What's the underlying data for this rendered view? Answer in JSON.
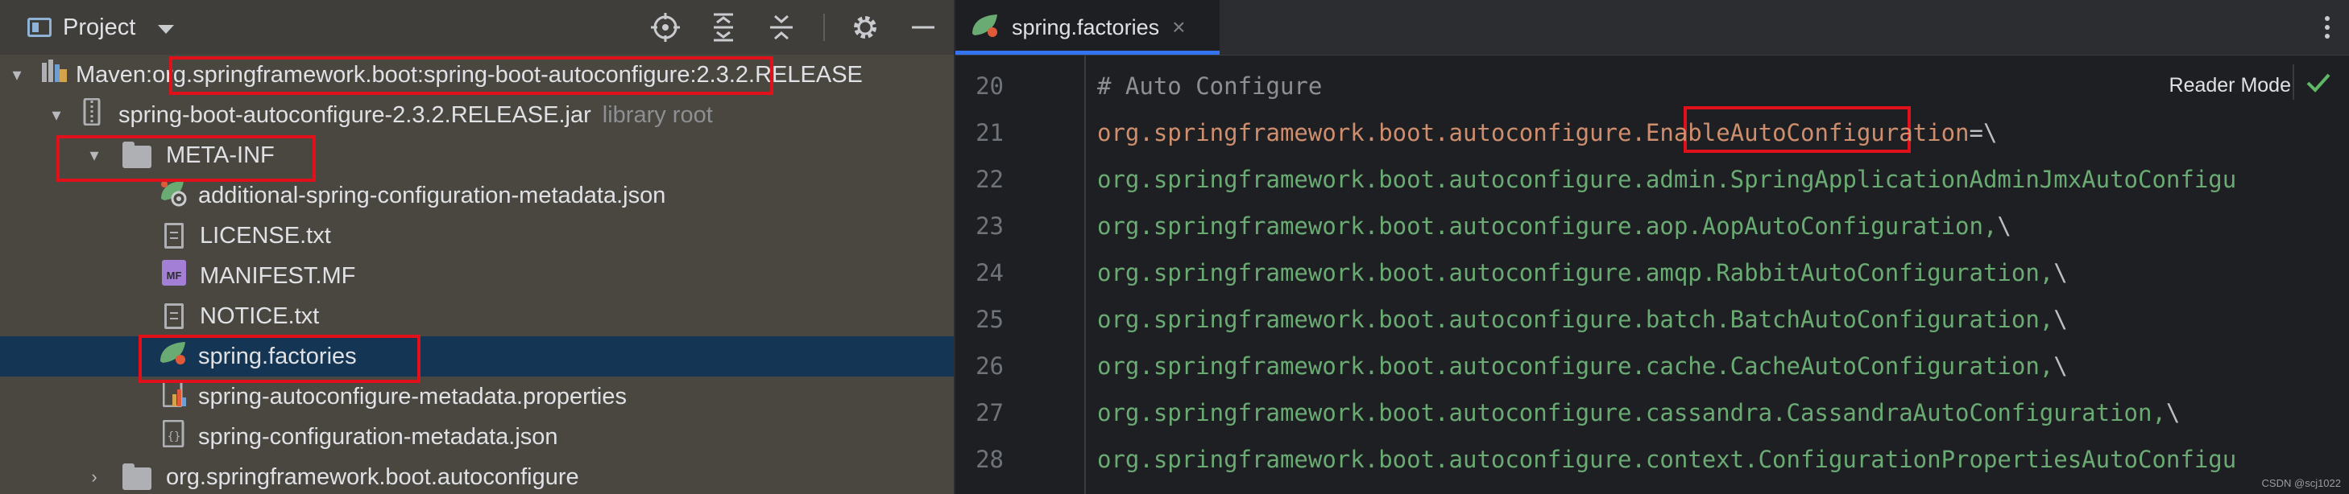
{
  "project_panel": {
    "title": "Project",
    "header_icons": [
      "locate-icon",
      "expand-all-icon",
      "collapse-all-icon",
      "gear-icon",
      "minimize-icon"
    ],
    "tree": [
      {
        "prefix": "Maven: ",
        "label": "org.springframework.boot:spring-boot-autoconfigure:",
        "suffix": "2.3.2.RELEASE",
        "icon": "maven-library-icon",
        "expanded": true
      },
      {
        "label": "spring-boot-autoconfigure-2.3.2.RELEASE.jar",
        "hint": "library root",
        "icon": "jar-icon",
        "expanded": true
      },
      {
        "label": "META-INF",
        "icon": "folder-icon",
        "expanded": true
      },
      {
        "label": "additional-spring-configuration-metadata.json",
        "icon": "spring-json-icon"
      },
      {
        "label": "LICENSE.txt",
        "icon": "text-file-icon"
      },
      {
        "label": "MANIFEST.MF",
        "icon": "manifest-icon"
      },
      {
        "label": "NOTICE.txt",
        "icon": "text-file-icon"
      },
      {
        "label": "spring.factories",
        "icon": "spring-leaf-icon",
        "selected": true
      },
      {
        "label": "spring-autoconfigure-metadata.properties",
        "icon": "properties-icon"
      },
      {
        "label": "spring-configuration-metadata.json",
        "icon": "json-icon"
      },
      {
        "label": "org.springframework.boot.autoconfigure",
        "icon": "folder-icon",
        "expanded": false
      }
    ]
  },
  "editor": {
    "tab": {
      "label": "spring.factories",
      "close": "×"
    },
    "reader_mode": "Reader Mode",
    "lines": [
      {
        "num": "20",
        "parts": [
          {
            "t": "# Auto Configure",
            "c": "comment"
          }
        ]
      },
      {
        "num": "21",
        "parts": [
          {
            "t": "org.springframework.boot.autoconfigure",
            "c": "key"
          },
          {
            "t": ".EnableAutoConfiguration",
            "c": "key"
          },
          {
            "t": "=\\",
            "c": "plain"
          }
        ]
      },
      {
        "num": "22",
        "parts": [
          {
            "t": "org.springframework.boot.autoconfigure.admin.SpringApplicationAdminJmxAutoConfigu",
            "c": "val"
          }
        ]
      },
      {
        "num": "23",
        "parts": [
          {
            "t": "org.springframework.boot.autoconfigure.aop.AopAutoConfiguration,",
            "c": "val"
          },
          {
            "t": "\\",
            "c": "plain"
          }
        ]
      },
      {
        "num": "24",
        "parts": [
          {
            "t": "org.springframework.boot.autoconfigure.amqp.RabbitAutoConfiguration,",
            "c": "val"
          },
          {
            "t": "\\",
            "c": "plain"
          }
        ]
      },
      {
        "num": "25",
        "parts": [
          {
            "t": "org.springframework.boot.autoconfigure.batch.BatchAutoConfiguration,",
            "c": "val"
          },
          {
            "t": "\\",
            "c": "plain"
          }
        ]
      },
      {
        "num": "26",
        "parts": [
          {
            "t": "org.springframework.boot.autoconfigure.cache.CacheAutoConfiguration,",
            "c": "val"
          },
          {
            "t": "\\",
            "c": "plain"
          }
        ]
      },
      {
        "num": "27",
        "parts": [
          {
            "t": "org.springframework.boot.autoconfigure.cassandra.CassandraAutoConfiguration,",
            "c": "val"
          },
          {
            "t": "\\",
            "c": "plain"
          }
        ]
      },
      {
        "num": "28",
        "parts": [
          {
            "t": "org.springframework.boot.autoconfigure.context.ConfigurationPropertiesAutoConfigu",
            "c": "val"
          }
        ]
      }
    ]
  },
  "watermark": "CSDN @scj1022",
  "colors": {
    "highlight_box": "#e0111a",
    "selection": "#143553",
    "key": "#cf8e6d",
    "value": "#6aab73",
    "accent": "#3574f0"
  }
}
